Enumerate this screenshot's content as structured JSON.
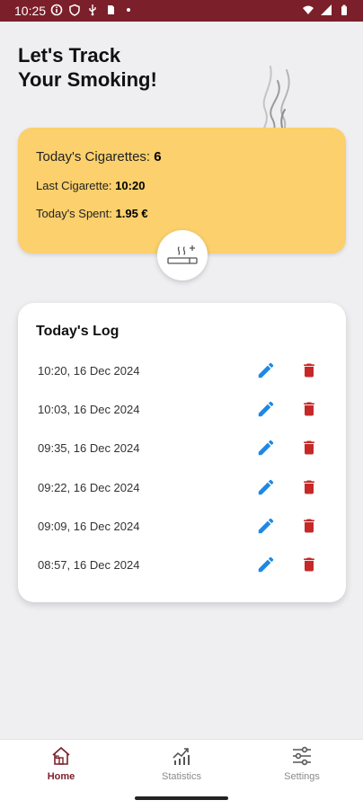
{
  "status_bar": {
    "time": "10:25",
    "left_icons": [
      "info-circle-icon",
      "shield-icon",
      "usb-icon",
      "sim-card-icon",
      "dot-icon"
    ],
    "right_icons": [
      "wifi-icon",
      "signal-icon",
      "battery-icon"
    ]
  },
  "header": {
    "title_line1": "Let's Track",
    "title_line2": "Your Smoking!"
  },
  "summary": {
    "count_label": "Today's Cigarettes:",
    "count_value": "6",
    "last_label": "Last Cigarette:",
    "last_value": "10:20",
    "spent_label": "Today's Spent:",
    "spent_value": "1.95 €"
  },
  "log": {
    "title": "Today's Log",
    "entries": [
      "10:20, 16 Dec 2024",
      "10:03, 16 Dec 2024",
      "09:35, 16 Dec 2024",
      "09:22, 16 Dec 2024",
      "09:09, 16 Dec 2024",
      "08:57, 16 Dec 2024"
    ]
  },
  "nav": {
    "home": "Home",
    "statistics": "Statistics",
    "settings": "Settings"
  },
  "colors": {
    "accent": "#7b1f2a",
    "card_yellow": "#fbd06d",
    "edit_blue": "#1e88e5",
    "delete_red": "#c62828"
  }
}
